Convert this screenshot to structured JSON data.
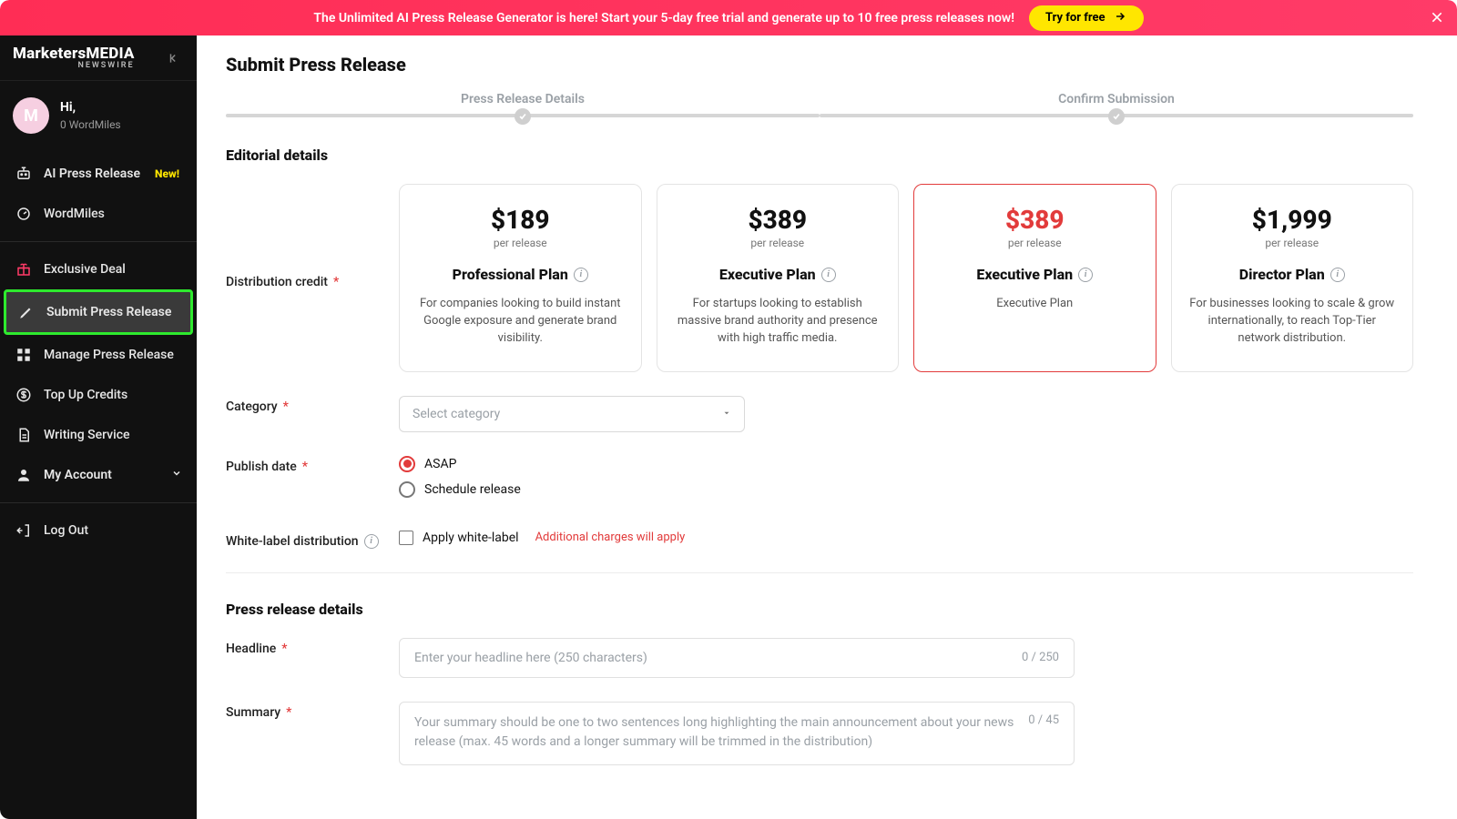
{
  "banner": {
    "text": "The Unlimited AI Press Release Generator is here! Start your 5-day free trial and generate up to 10 free press releases now!",
    "cta": "Try for free"
  },
  "brand": {
    "line1": "MarketersMEDIA",
    "line2": "NEWSWIRE"
  },
  "user": {
    "initial": "M",
    "greeting": "Hi,",
    "miles": "0 WordMiles"
  },
  "nav": {
    "ai": "AI Press Release",
    "ai_badge": "New!",
    "wordmiles": "WordMiles",
    "exclusive": "Exclusive Deal",
    "submit": "Submit Press Release",
    "manage": "Manage Press Release",
    "topup": "Top Up Credits",
    "writing": "Writing Service",
    "account": "My Account",
    "logout": "Log Out"
  },
  "page": {
    "title": "Submit Press Release"
  },
  "stepper": {
    "a": "Press Release Details",
    "b": "Confirm Submission"
  },
  "editorial": {
    "title": "Editorial details",
    "dist_label": "Distribution credit",
    "category_label": "Category",
    "category_placeholder": "Select category",
    "publish_label": "Publish date",
    "publish_asap": "ASAP",
    "publish_schedule": "Schedule release",
    "white_label_label": "White-label distribution",
    "white_label_check": "Apply white-label",
    "white_label_warn": "Additional charges will apply"
  },
  "plans": [
    {
      "price": "$189",
      "per": "per release",
      "name": "Professional Plan",
      "desc": "For companies looking to build instant Google exposure and generate brand visibility."
    },
    {
      "price": "$389",
      "per": "per release",
      "name": "Executive Plan",
      "desc": "For startups looking to establish massive brand authority and presence with high traffic media."
    },
    {
      "price": "$389",
      "per": "per release",
      "name": "Executive Plan",
      "desc": "Executive Plan"
    },
    {
      "price": "$1,999",
      "per": "per release",
      "name": "Director Plan",
      "desc": "For businesses looking to scale & grow internationally, to reach Top-Tier network distribution."
    }
  ],
  "details": {
    "title": "Press release details",
    "headline_label": "Headline",
    "headline_ph": "Enter your headline here (250 characters)",
    "headline_counter": "0 / 250",
    "summary_label": "Summary",
    "summary_ph": "Your summary should be one to two sentences long highlighting the main announcement about your news release (max. 45 words and a longer summary will be trimmed in the distribution)",
    "summary_counter": "0 / 45"
  }
}
